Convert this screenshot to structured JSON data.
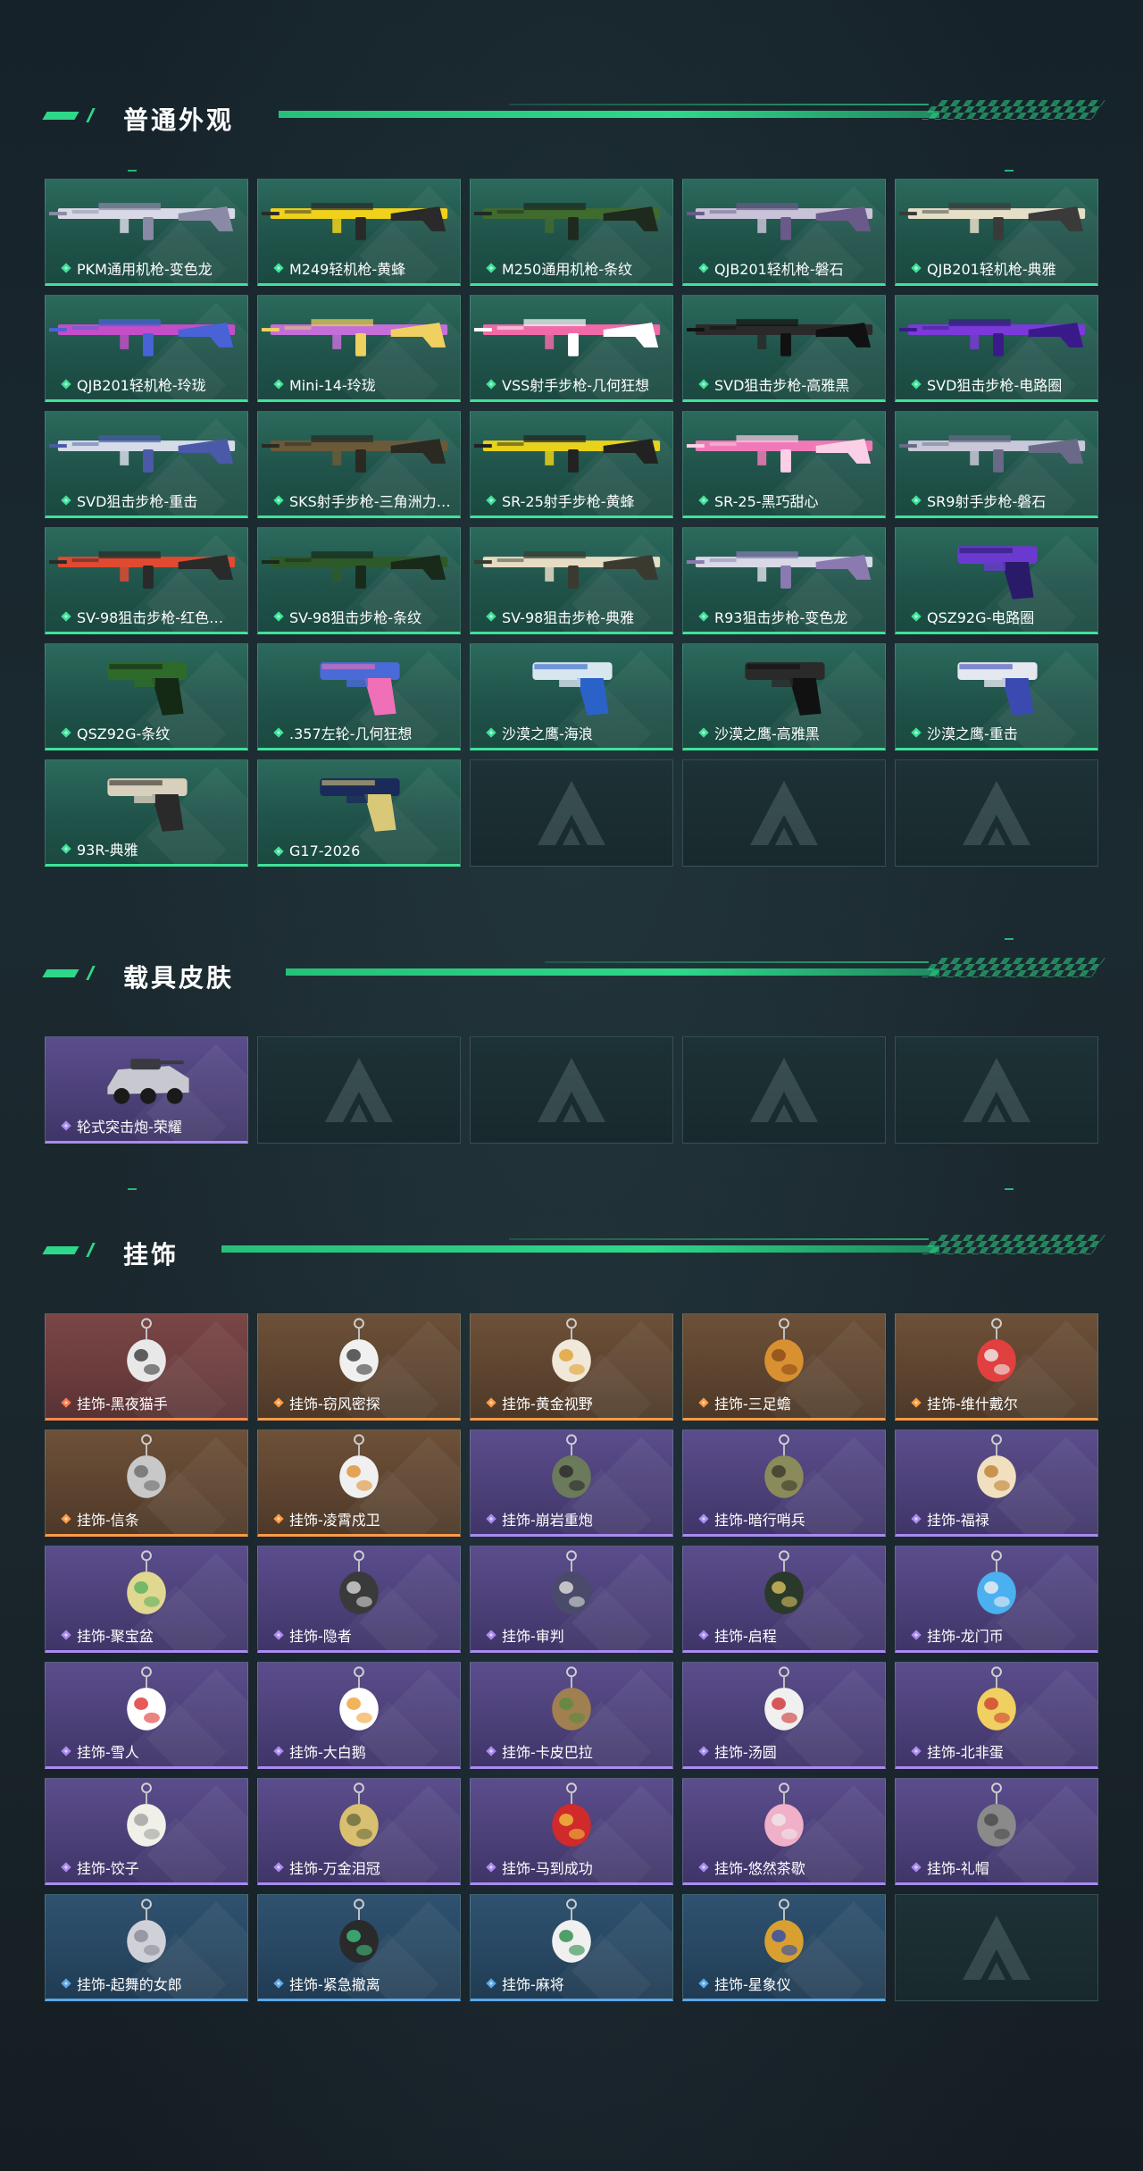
{
  "sections": {
    "weapons": {
      "title": "普通外观",
      "items": [
        {
          "label": "PKM通用机枪-变色龙",
          "rarity": "green",
          "colors": [
            "#d8d8e6",
            "#8a8aa6"
          ]
        },
        {
          "label": "M249轻机枪-黄蜂",
          "rarity": "green",
          "colors": [
            "#f0d21c",
            "#2a2a2a"
          ]
        },
        {
          "label": "M250通用机枪-条纹",
          "rarity": "green",
          "colors": [
            "#3f6b2e",
            "#1e2a1e"
          ]
        },
        {
          "label": "QJB201轻机枪-磐石",
          "rarity": "green",
          "colors": [
            "#c9c2d8",
            "#6a5a8a"
          ]
        },
        {
          "label": "QJB201轻机枪-典雅",
          "rarity": "green",
          "colors": [
            "#e6dfc8",
            "#3a3a3a"
          ]
        },
        {
          "label": "QJB201轻机枪-玲珑",
          "rarity": "green",
          "colors": [
            "#c34ec8",
            "#4a62d8"
          ]
        },
        {
          "label": "Mini-14-玲珑",
          "rarity": "green",
          "colors": [
            "#c46fd8",
            "#f0d060"
          ]
        },
        {
          "label": "VSS射手步枪-几何狂想",
          "rarity": "green",
          "colors": [
            "#f06aa8",
            "#ffffff"
          ]
        },
        {
          "label": "SVD狙击步枪-高雅黑",
          "rarity": "green",
          "colors": [
            "#2a2a2a",
            "#111111"
          ]
        },
        {
          "label": "SVD狙击步枪-电路圈",
          "rarity": "green",
          "colors": [
            "#7a3ad8",
            "#3a1a8a"
          ]
        },
        {
          "label": "SVD狙击步枪-重击",
          "rarity": "green",
          "colors": [
            "#d6dbe8",
            "#4a5aa8"
          ]
        },
        {
          "label": "SKS射手步枪-三角洲力…",
          "rarity": "green",
          "colors": [
            "#6b5a3a",
            "#2a2a22"
          ]
        },
        {
          "label": "SR-25射手步枪-黄蜂",
          "rarity": "green",
          "colors": [
            "#e8d21c",
            "#222222"
          ]
        },
        {
          "label": "SR-25-黑巧甜心",
          "rarity": "green",
          "colors": [
            "#f07ab8",
            "#fbd0e6"
          ]
        },
        {
          "label": "SR9射手步枪-磐石",
          "rarity": "green",
          "colors": [
            "#c8c8d8",
            "#6a6a88"
          ]
        },
        {
          "label": "SV-98狙击步枪-红色…",
          "rarity": "green",
          "colors": [
            "#e04a30",
            "#2a2a2a"
          ]
        },
        {
          "label": "SV-98狙击步枪-条纹",
          "rarity": "green",
          "colors": [
            "#2e5a2a",
            "#1a2a1a"
          ]
        },
        {
          "label": "SV-98狙击步枪-典雅",
          "rarity": "green",
          "colors": [
            "#e6dcc4",
            "#3a3a30"
          ]
        },
        {
          "label": "R93狙击步枪-变色龙",
          "rarity": "green",
          "colors": [
            "#d8d8e6",
            "#8a7ab0"
          ]
        },
        {
          "label": "QSZ92G-电路圈",
          "rarity": "green",
          "colors": [
            "#6a3ad0",
            "#2a1a6a"
          ]
        },
        {
          "label": "QSZ92G-条纹",
          "rarity": "green",
          "colors": [
            "#2e6a2a",
            "#142a14"
          ]
        },
        {
          "label": ".357左轮-几何狂想",
          "rarity": "green",
          "colors": [
            "#4a6ad8",
            "#f070b8"
          ]
        },
        {
          "label": "沙漠之鹰-海浪",
          "rarity": "green",
          "colors": [
            "#d8e6f0",
            "#2a62c8"
          ]
        },
        {
          "label": "沙漠之鹰-高雅黑",
          "rarity": "green",
          "colors": [
            "#2a2a2a",
            "#111111"
          ]
        },
        {
          "label": "沙漠之鹰-重击",
          "rarity": "green",
          "colors": [
            "#e6e8f0",
            "#3a4ab0"
          ]
        },
        {
          "label": "93R-典雅",
          "rarity": "green",
          "colors": [
            "#d8d0bc",
            "#2a2a2a"
          ]
        },
        {
          "label": "G17-2026",
          "rarity": "green",
          "colors": [
            "#1a2a5a",
            "#d8c878"
          ]
        },
        {
          "label": "",
          "rarity": "empty"
        },
        {
          "label": "",
          "rarity": "empty"
        },
        {
          "label": "",
          "rarity": "empty"
        }
      ]
    },
    "vehicles": {
      "title": "载具皮肤",
      "items": [
        {
          "label": "轮式突击炮-荣耀",
          "rarity": "purple",
          "colors": [
            "#c8c8d0",
            "#3a3a40"
          ]
        },
        {
          "label": "",
          "rarity": "empty"
        },
        {
          "label": "",
          "rarity": "empty"
        },
        {
          "label": "",
          "rarity": "empty"
        },
        {
          "label": "",
          "rarity": "empty"
        }
      ]
    },
    "charms": {
      "title": "挂饰",
      "items": [
        {
          "label": "挂饰-黑夜猫手",
          "rarity": "red",
          "colors": [
            "#e8e8e8",
            "#3a3a3a"
          ]
        },
        {
          "label": "挂饰-窃风密探",
          "rarity": "orange",
          "colors": [
            "#f0f0f0",
            "#3a3a3a"
          ]
        },
        {
          "label": "挂饰-黄金视野",
          "rarity": "orange",
          "colors": [
            "#f0e8d8",
            "#e0a030"
          ]
        },
        {
          "label": "挂饰-三足蟾",
          "rarity": "orange",
          "colors": [
            "#d89030",
            "#8a4a18"
          ]
        },
        {
          "label": "挂饰-维什戴尔",
          "rarity": "orange",
          "colors": [
            "#e04040",
            "#f0f0f0"
          ]
        },
        {
          "label": "挂饰-信条",
          "rarity": "orange",
          "colors": [
            "#c8c8c8",
            "#6a6a6a"
          ]
        },
        {
          "label": "挂饰-凌霄戍卫",
          "rarity": "orange",
          "colors": [
            "#f0f0f0",
            "#e09030"
          ]
        },
        {
          "label": "挂饰-崩岩重炮",
          "rarity": "purple",
          "colors": [
            "#6a7a5a",
            "#2a2a2a"
          ]
        },
        {
          "label": "挂饰-暗行哨兵",
          "rarity": "purple",
          "colors": [
            "#8a8a5a",
            "#3a3a2a"
          ]
        },
        {
          "label": "挂饰-福禄",
          "rarity": "purple",
          "colors": [
            "#f0e0c0",
            "#c08030"
          ]
        },
        {
          "label": "挂饰-聚宝盆",
          "rarity": "purple",
          "colors": [
            "#e0d890",
            "#5ab060"
          ]
        },
        {
          "label": "挂饰-隐者",
          "rarity": "purple",
          "colors": [
            "#3a3a3a",
            "#d8d8d8"
          ]
        },
        {
          "label": "挂饰-审判",
          "rarity": "purple",
          "colors": [
            "#4a4a6a",
            "#e0e0e0"
          ]
        },
        {
          "label": "挂饰-启程",
          "rarity": "purple",
          "colors": [
            "#2a3a2a",
            "#d8c060"
          ]
        },
        {
          "label": "挂饰-龙门币",
          "rarity": "purple",
          "colors": [
            "#4ab0f0",
            "#f0f0f0"
          ]
        },
        {
          "label": "挂饰-雪人",
          "rarity": "purple",
          "colors": [
            "#ffffff",
            "#e03030"
          ]
        },
        {
          "label": "挂饰-大白鹅",
          "rarity": "purple",
          "colors": [
            "#ffffff",
            "#f0a030"
          ]
        },
        {
          "label": "挂饰-卡皮巴拉",
          "rarity": "purple",
          "colors": [
            "#a08050",
            "#5a8a40"
          ]
        },
        {
          "label": "挂饰-汤圆",
          "rarity": "purple",
          "colors": [
            "#f0f0f0",
            "#d03030"
          ]
        },
        {
          "label": "挂饰-北非蛋",
          "rarity": "purple",
          "colors": [
            "#f0d060",
            "#d04030"
          ]
        },
        {
          "label": "挂饰-饺子",
          "rarity": "purple",
          "colors": [
            "#f0f0e8",
            "#a0a0a0"
          ]
        },
        {
          "label": "挂饰-万金泪冠",
          "rarity": "purple",
          "colors": [
            "#d8c070",
            "#6a6a40"
          ]
        },
        {
          "label": "挂饰-马到成功",
          "rarity": "purple",
          "colors": [
            "#d02a2a",
            "#f0c040"
          ]
        },
        {
          "label": "挂饰-悠然茶歇",
          "rarity": "purple",
          "colors": [
            "#f0b0c8",
            "#f0e8e8"
          ]
        },
        {
          "label": "挂饰-礼帽",
          "rarity": "purple",
          "colors": [
            "#8a8a8a",
            "#4a4a4a"
          ]
        },
        {
          "label": "挂饰-起舞的女郎",
          "rarity": "blue",
          "colors": [
            "#d0d0d8",
            "#8a8a98"
          ]
        },
        {
          "label": "挂饰-紧急撤离",
          "rarity": "blue",
          "colors": [
            "#2a2a2a",
            "#40c080"
          ]
        },
        {
          "label": "挂饰-麻将",
          "rarity": "blue",
          "colors": [
            "#f0f0f0",
            "#2a8a4a"
          ]
        },
        {
          "label": "挂饰-星象仪",
          "rarity": "blue",
          "colors": [
            "#d8a030",
            "#2a4ab0"
          ]
        },
        {
          "label": "",
          "rarity": "empty"
        }
      ]
    }
  }
}
